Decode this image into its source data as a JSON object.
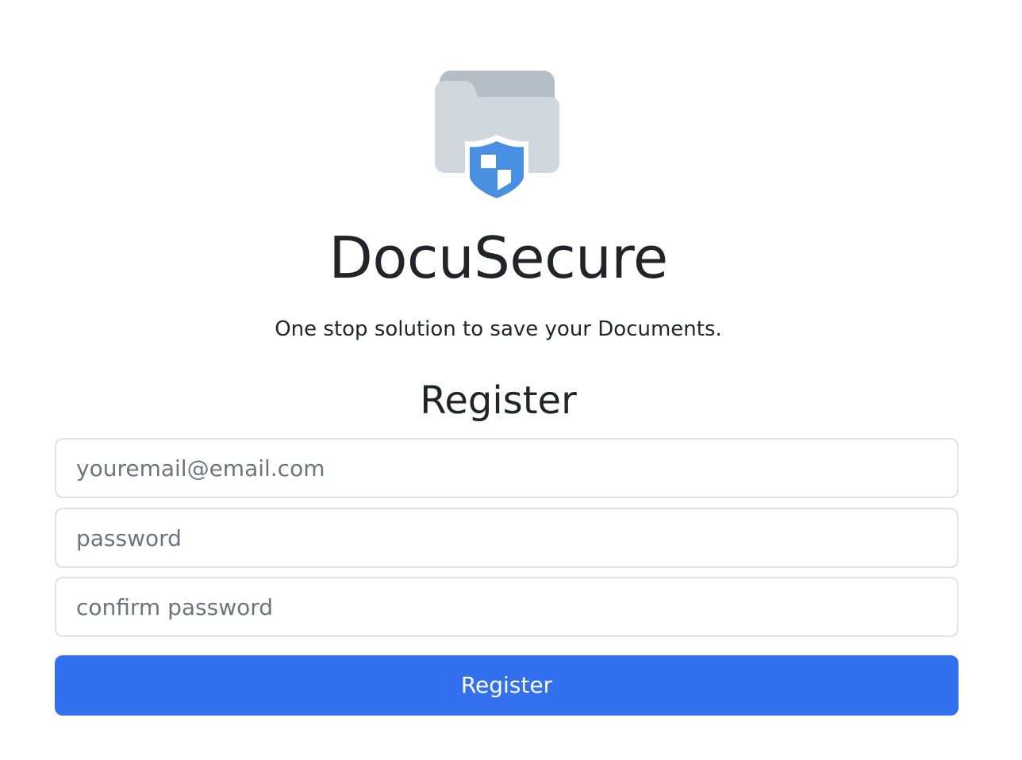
{
  "brand": {
    "name": "DocuSecure",
    "tagline": "One stop solution to save your Documents.",
    "logo_icon": "folder-shield-icon"
  },
  "form": {
    "title": "Register",
    "email_placeholder": "youremail@email.com",
    "email_value": "",
    "password_placeholder": "password",
    "password_value": "",
    "confirm_placeholder": "confirm password",
    "confirm_value": "",
    "submit_label": "Register"
  },
  "colors": {
    "primary": "#3370f0",
    "shield": "#4a90e2",
    "folder_back": "#b5bec6",
    "folder_front": "#d1d8dd",
    "text": "#212529",
    "placeholder": "#6c757d",
    "border": "#dee2e6"
  }
}
